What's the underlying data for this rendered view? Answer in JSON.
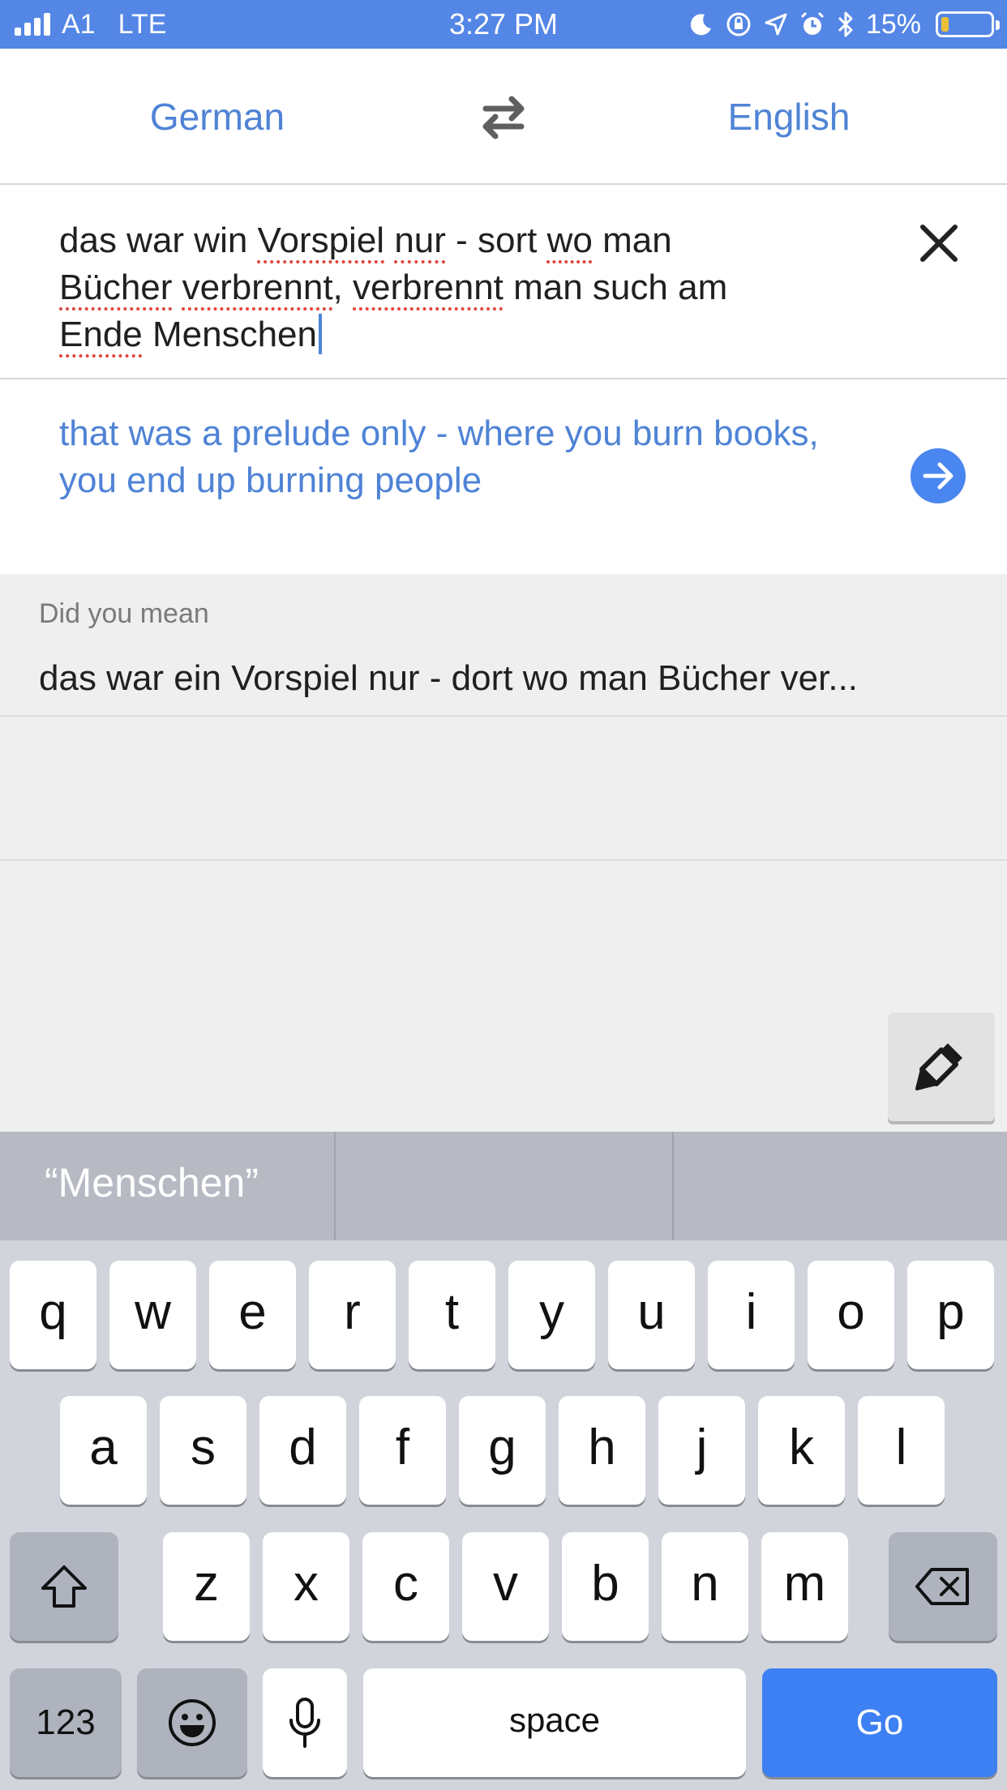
{
  "status_bar": {
    "carrier": "A1",
    "network": "LTE",
    "time": "3:27 PM",
    "battery_percent": "15%",
    "battery_level": 0.15,
    "icons": [
      "signal-icon",
      "moon-icon",
      "orientation-lock-icon",
      "location-icon",
      "alarm-icon",
      "bluetooth-icon",
      "battery-icon"
    ]
  },
  "language_bar": {
    "source_language": "German",
    "target_language": "English",
    "swap_icon": "swap-arrows-icon"
  },
  "input": {
    "text_segments": [
      "das war win ",
      "Vorspiel",
      " ",
      "nur",
      " - sort ",
      "wo",
      " man",
      "Bücher",
      " ",
      "verbrennt",
      ", ",
      "verbrennt",
      " man such am",
      "Ende",
      " Menschen"
    ],
    "clear_icon": "close-icon"
  },
  "translation": {
    "text": "that was a prelude only - where you burn books, you end up burning people",
    "action_icon": "arrow-right-icon"
  },
  "suggestions": {
    "header": "Did you mean",
    "suggestion": "das war ein Vorspiel nur - dort wo man Bücher ver..."
  },
  "handwriting_icon": "pen-icon",
  "keyboard": {
    "prediction": "“Menschen”",
    "row1": [
      "q",
      "w",
      "e",
      "r",
      "t",
      "y",
      "u",
      "i",
      "o",
      "p"
    ],
    "row2": [
      "a",
      "s",
      "d",
      "f",
      "g",
      "h",
      "j",
      "k",
      "l"
    ],
    "row3": [
      "z",
      "x",
      "c",
      "v",
      "b",
      "n",
      "m"
    ],
    "numbers_label": "123",
    "space_label": "space",
    "go_label": "Go",
    "icons": [
      "shift-icon",
      "backspace-icon",
      "emoji-icon",
      "microphone-icon"
    ]
  },
  "colors": {
    "status_bar": "#5486e6",
    "accent": "#4f83d6",
    "go_key": "#3d80f3",
    "spellcheck": "#e0463c"
  }
}
